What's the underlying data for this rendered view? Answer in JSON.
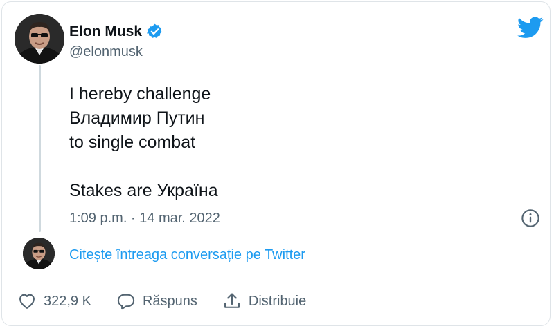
{
  "author": {
    "name": "Elon Musk",
    "handle": "@elonmusk",
    "verified": true
  },
  "tweet": {
    "text": "I hereby challenge\nВладимир Путин\nto single combat\n\nStakes are Україна",
    "timestamp": "1:09 p.m. · 14 mar. 2022"
  },
  "conversation_link": "Citește întreaga conversație pe Twitter",
  "actions": {
    "likes": "322,9 K",
    "reply": "Răspuns",
    "share": "Distribuie"
  },
  "colors": {
    "brand": "#1d9bf0",
    "text": "#0f1419",
    "secondary": "#536471"
  },
  "icons": [
    "verified-badge-icon",
    "twitter-bird-icon",
    "info-icon",
    "heart-icon",
    "reply-bubble-icon",
    "share-icon"
  ]
}
